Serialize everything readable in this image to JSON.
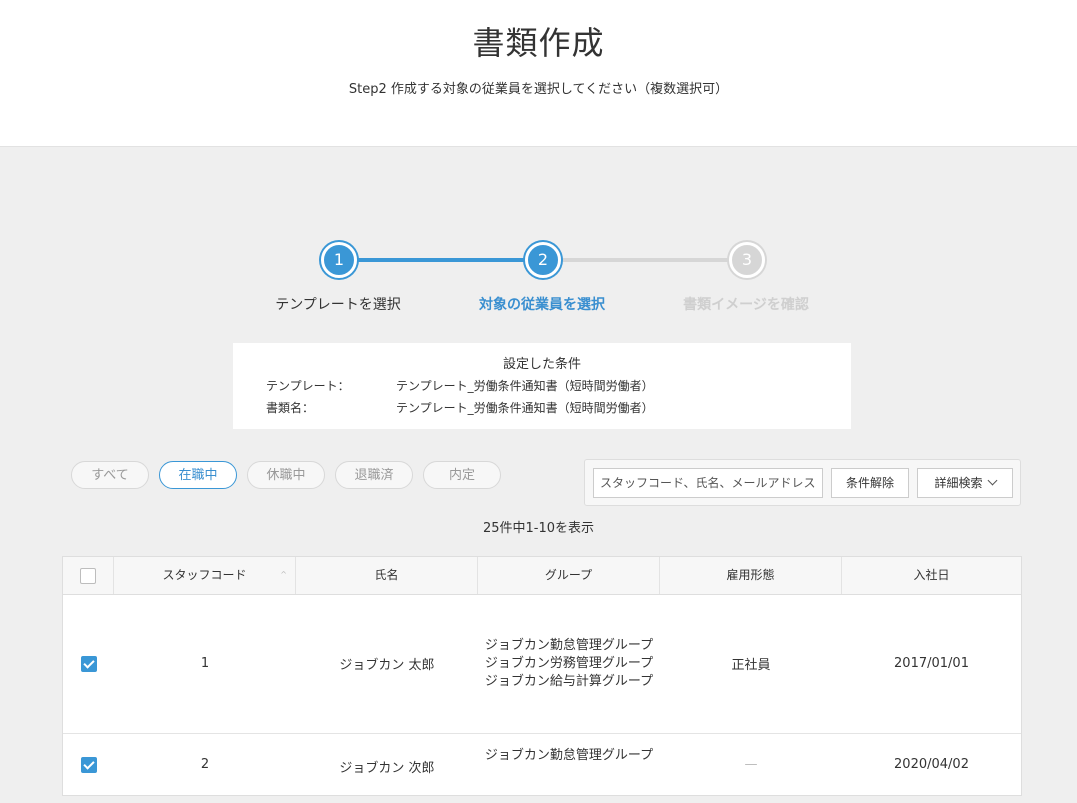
{
  "header": {
    "title": "書類作成",
    "subtitle": "Step2 作成する対象の従業員を選択してください（複数選択可）"
  },
  "stepper": [
    {
      "number": "1",
      "label": "テンプレートを選択",
      "state": "done"
    },
    {
      "number": "2",
      "label": "対象の従業員を選択",
      "state": "current"
    },
    {
      "number": "3",
      "label": "書類イメージを確認",
      "state": "upcoming"
    }
  ],
  "conditions": {
    "title": "設定した条件",
    "rows": [
      {
        "key": "テンプレート：",
        "value": "テンプレート_労働条件通知書（短時間労働者）"
      },
      {
        "key": "書類名：",
        "value": "テンプレート_労働条件通知書（短時間労働者）"
      }
    ]
  },
  "filters": [
    "すべて",
    "在職中",
    "休職中",
    "退職済",
    "内定"
  ],
  "active_filter": "在職中",
  "search": {
    "placeholder": "スタッフコード、氏名、メールアドレス",
    "clear_label": "条件解除",
    "advanced_label": "詳細検索"
  },
  "result_count": "25件中1-10を表示",
  "table": {
    "columns": [
      "スタッフコード",
      "氏名",
      "グループ",
      "雇用形態",
      "入社日"
    ],
    "rows": [
      {
        "checked": true,
        "code": "1",
        "name": "ジョブカン 太郎",
        "groups": [
          "ジョブカン勤怠管理グループ",
          "ジョブカン労務管理グループ",
          "ジョブカン給与計算グループ"
        ],
        "employment": "正社員",
        "join_date": "2017/01/01"
      },
      {
        "checked": true,
        "code": "2",
        "name": "ジョブカン 次郎",
        "groups": [
          "ジョブカン勤怠管理グループ"
        ],
        "employment": "—",
        "join_date": "2020/04/02"
      }
    ]
  },
  "colors": {
    "accent": "#3a97d6",
    "inactive": "#d6d6d6",
    "background": "#efefef"
  }
}
